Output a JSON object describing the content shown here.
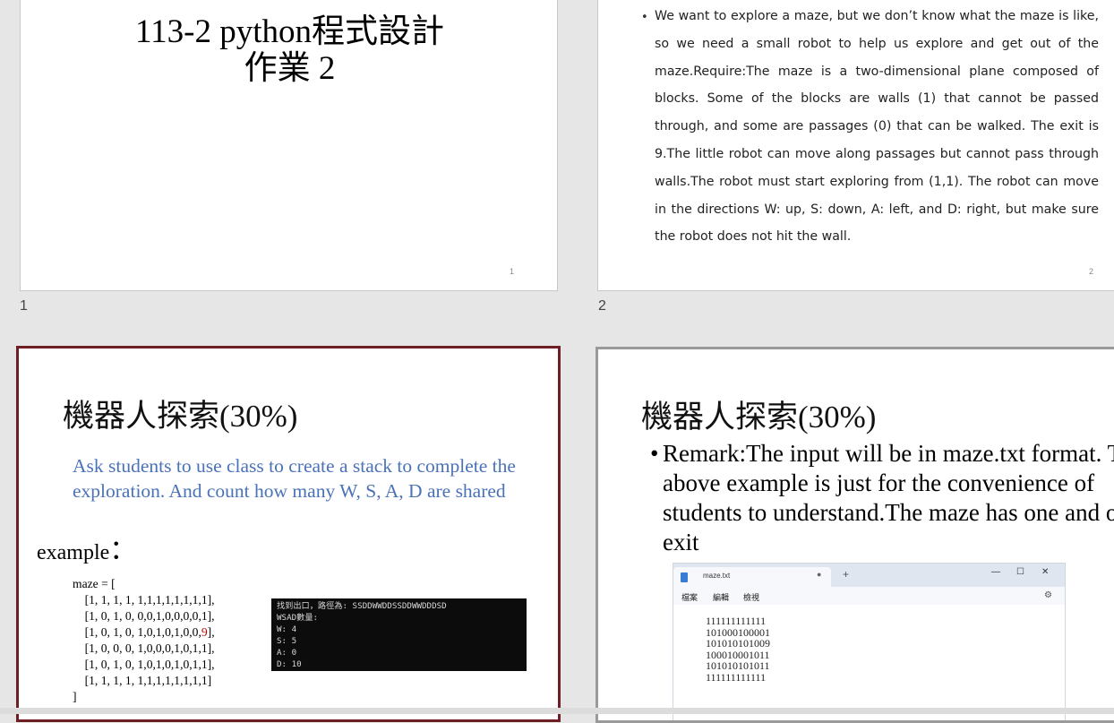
{
  "slides": [
    {
      "number": "1",
      "page": "1",
      "title_line1": "113-2 python程式設計",
      "title_line2": "作業 2"
    },
    {
      "number": "2",
      "page": "2",
      "bullet": "•",
      "body": "We want to explore a maze, but we don’t know what the maze is like, so we need a small robot to help us explore and get out of the maze.Require:The maze is a two-dimensional plane composed of blocks. Some of the blocks are walls (1) that cannot be passed through, and some are passages (0) that can be walked. The exit is 9.The little robot can move along passages but cannot pass through walls.The robot must start exploring from (1,1). The robot can move in the directions W: up, S: down, A: left, and D: right, but make sure the robot does not hit the wall."
    },
    {
      "heading": "機器人探索(30%)",
      "instruction": "Ask students to use class to create a stack to complete the exploration. And count how many W, S, A, D are shared",
      "example_label": "example",
      "example_colon": "：",
      "code": {
        "open": "maze = [",
        "rows": [
          "[1, 1, 1, 1, 1,1,1,1,1,1,1,1],",
          "[1, 0, 1, 0, 0,0,1,0,0,0,0,1],",
          "[1, 0, 1, 0, 1,0,1,0,1,0,0,",
          "[1, 0, 0, 0, 1,0,0,0,1,0,1,1],",
          "[1, 0, 1, 0, 1,0,1,0,1,0,1,1],",
          "[1, 1, 1, 1, 1,1,1,1,1,1,1,1]"
        ],
        "exit_value": "9",
        "exit_suffix": "],",
        "close": "]"
      },
      "console": {
        "line1": "找到出口，路徑為: SSDDWWDDSSDDWWDDDSD",
        "line2": "WSAD數量:",
        "line3": "W: 4",
        "line4": "S: 5",
        "line5": "A: 0",
        "line6": "D: 10"
      }
    },
    {
      "heading": "機器人探索(30%)",
      "bullet": "•",
      "body": "Remark:The input will be in maze.txt format. The above example is just for the convenience of students to understand.The maze has one and only exit",
      "notepad": {
        "tab_name": "maze.txt",
        "tab_close": "●",
        "new_tab": "+",
        "minimize": "—",
        "maximize": "☐",
        "close": "✕",
        "menu": [
          "檔案",
          "編輯",
          "檢視"
        ],
        "settings_icon": "⚙",
        "content": "111111111111\n101000100001\n101010101009\n100010001011\n101010101011\n111111111111"
      }
    }
  ]
}
